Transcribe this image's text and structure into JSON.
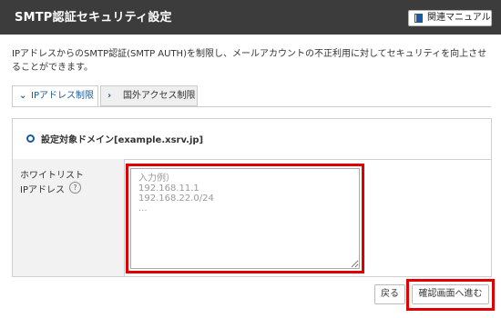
{
  "header": {
    "title": "SMTP認証セキュリティ設定",
    "manual_button_label": "関連マニュアル",
    "manual_icon": "book-icon"
  },
  "description": "IPアドレスからのSMTP認証(SMTP AUTH)を制限し、メールアカウントの不正利用に対してセキュリティを向上させることができます。",
  "tabs": [
    {
      "label": "IPアドレス制限",
      "active": true,
      "icon": "chevron-down-icon"
    },
    {
      "label": "国外アクセス制限",
      "active": false,
      "icon": "chevron-right-icon"
    }
  ],
  "domain": {
    "label": "設定対象ドメイン[example.xsrv.jp]"
  },
  "whitelist": {
    "label_line1": "ホワイトリスト",
    "label_line2": "IPアドレス",
    "help_icon": "?",
    "placeholder": "入力例）\n192.168.11.1\n192.168.22.0/24\n..."
  },
  "buttons": {
    "back_label": "戻る",
    "confirm_label": "確認画面へ進む"
  },
  "colors": {
    "header_bg": "#3c3c3c",
    "accent": "#1a5a9c",
    "highlight": "#e00000"
  }
}
